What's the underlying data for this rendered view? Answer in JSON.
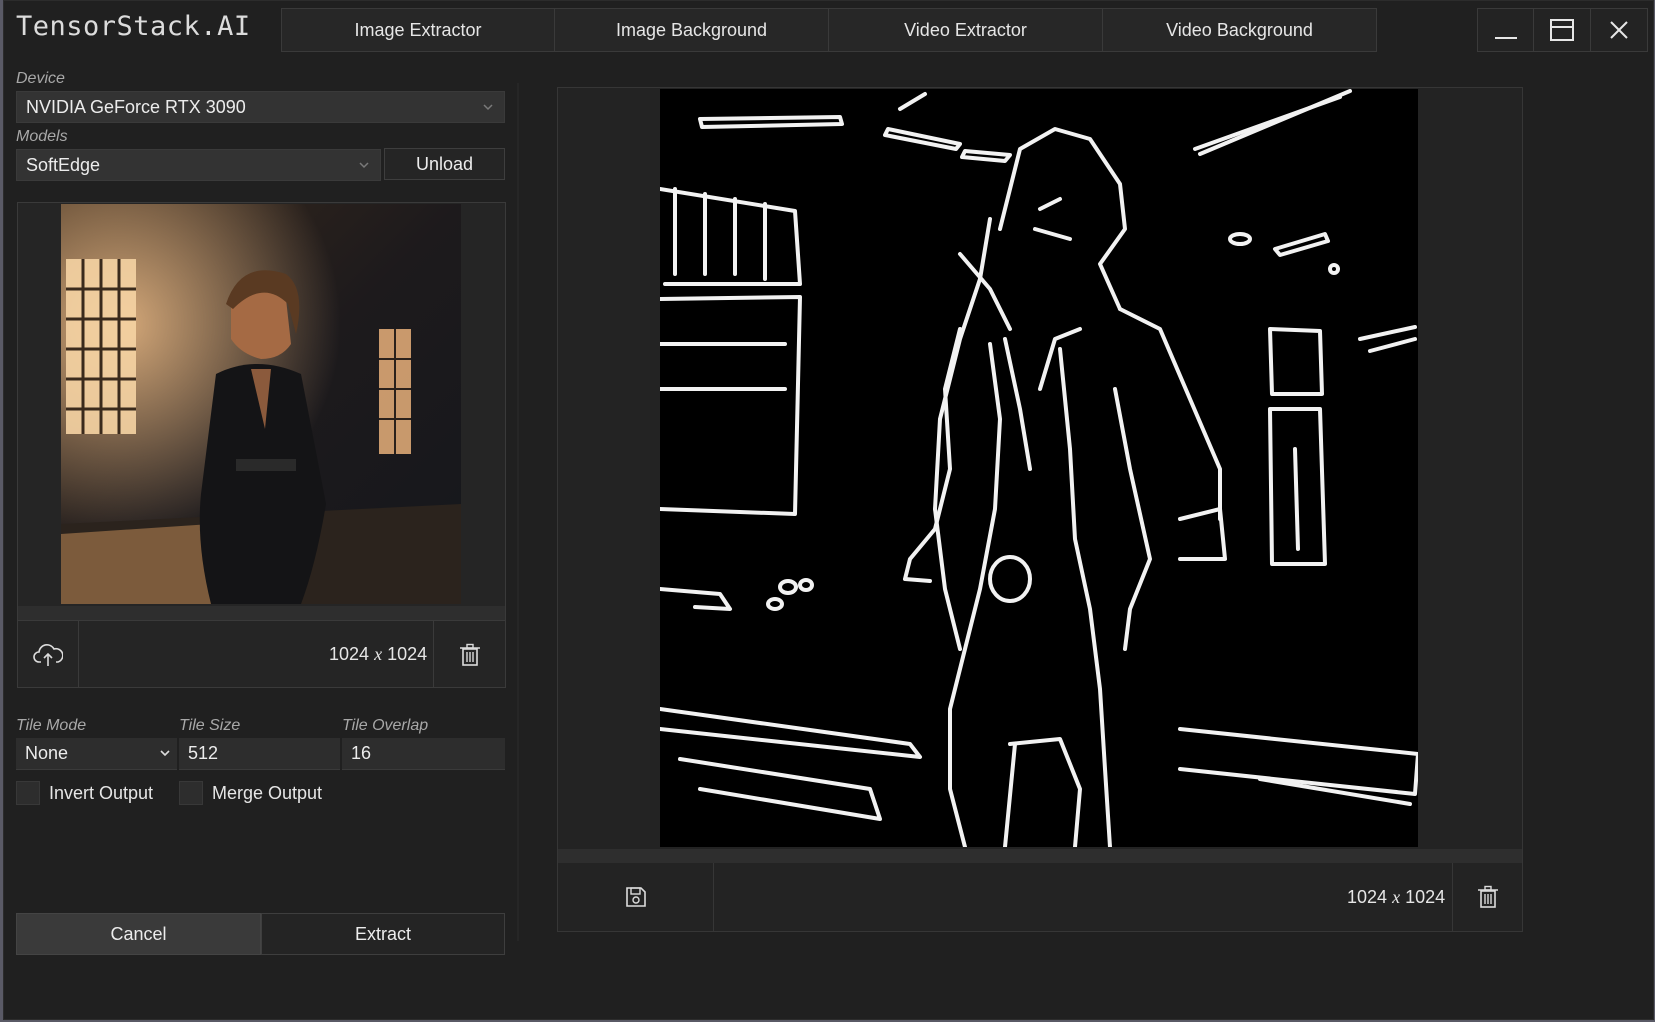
{
  "app": {
    "title": "TensorStack.AI"
  },
  "tabs": [
    {
      "label": "Image Extractor"
    },
    {
      "label": "Image Background"
    },
    {
      "label": "Video Extractor"
    },
    {
      "label": "Video Background"
    }
  ],
  "device": {
    "label": "Device",
    "value": "NVIDIA GeForce RTX 3090"
  },
  "models": {
    "label": "Models",
    "value": "SoftEdge",
    "unload_label": "Unload"
  },
  "input_image": {
    "width": "1024",
    "sep": "x",
    "height": "1024"
  },
  "tiling": {
    "mode_label": "Tile Mode",
    "mode_value": "None",
    "size_label": "Tile Size",
    "size_value": "512",
    "overlap_label": "Tile Overlap",
    "overlap_value": "16"
  },
  "options": {
    "invert_label": "Invert Output",
    "merge_label": "Merge Output"
  },
  "actions": {
    "cancel_label": "Cancel",
    "extract_label": "Extract"
  },
  "output_image": {
    "width": "1024",
    "sep": "x",
    "height": "1024"
  },
  "icons": {
    "upload": "cloud-upload-icon",
    "delete": "trash-icon",
    "save": "save-icon",
    "minimize": "minimize-icon",
    "maximize": "maximize-icon",
    "close": "close-icon",
    "dropdown": "chevron-down-icon"
  }
}
